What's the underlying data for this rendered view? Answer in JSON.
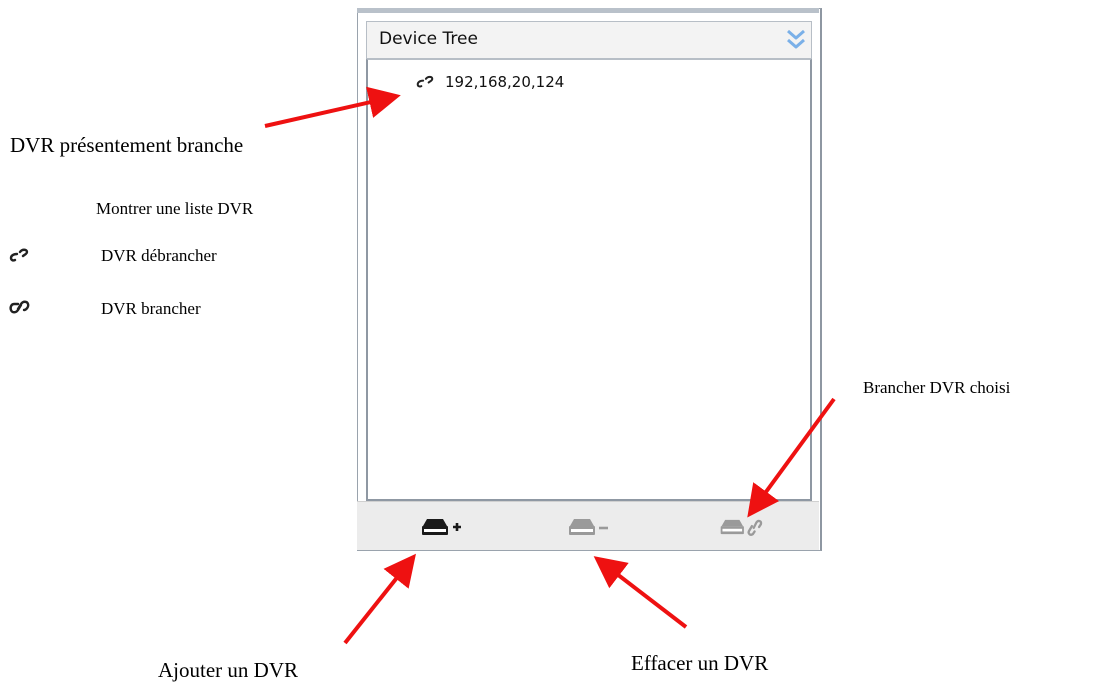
{
  "tree": {
    "title": "Device Tree",
    "collapse_icon": "double-chevron-down-icon",
    "nodes": [
      {
        "label": "192,168,20,124",
        "icon": "broken-link-icon",
        "status": "disconnected"
      }
    ]
  },
  "toolbar": {
    "buttons": [
      {
        "name": "add-dvr-button",
        "icon": "dvr-add-icon",
        "enabled": true
      },
      {
        "name": "delete-dvr-button",
        "icon": "dvr-remove-icon",
        "enabled": false
      },
      {
        "name": "connect-dvr-button",
        "icon": "dvr-link-icon",
        "enabled": false
      }
    ]
  },
  "annotations": {
    "connected_now": "DVR présentement branche",
    "show_list": "Montrer une liste DVR",
    "disconnected": "DVR débrancher",
    "connected": "DVR brancher",
    "connect_selected": "Brancher DVR choisi",
    "add": "Ajouter un DVR",
    "delete": "Effacer un DVR"
  },
  "colors": {
    "arrow": "#ee1111",
    "panel_border": "#9aa3ad",
    "header_bg": "#f3f3f3",
    "toolbar_bg": "#ececec",
    "chevron": "#7ab0e8"
  }
}
